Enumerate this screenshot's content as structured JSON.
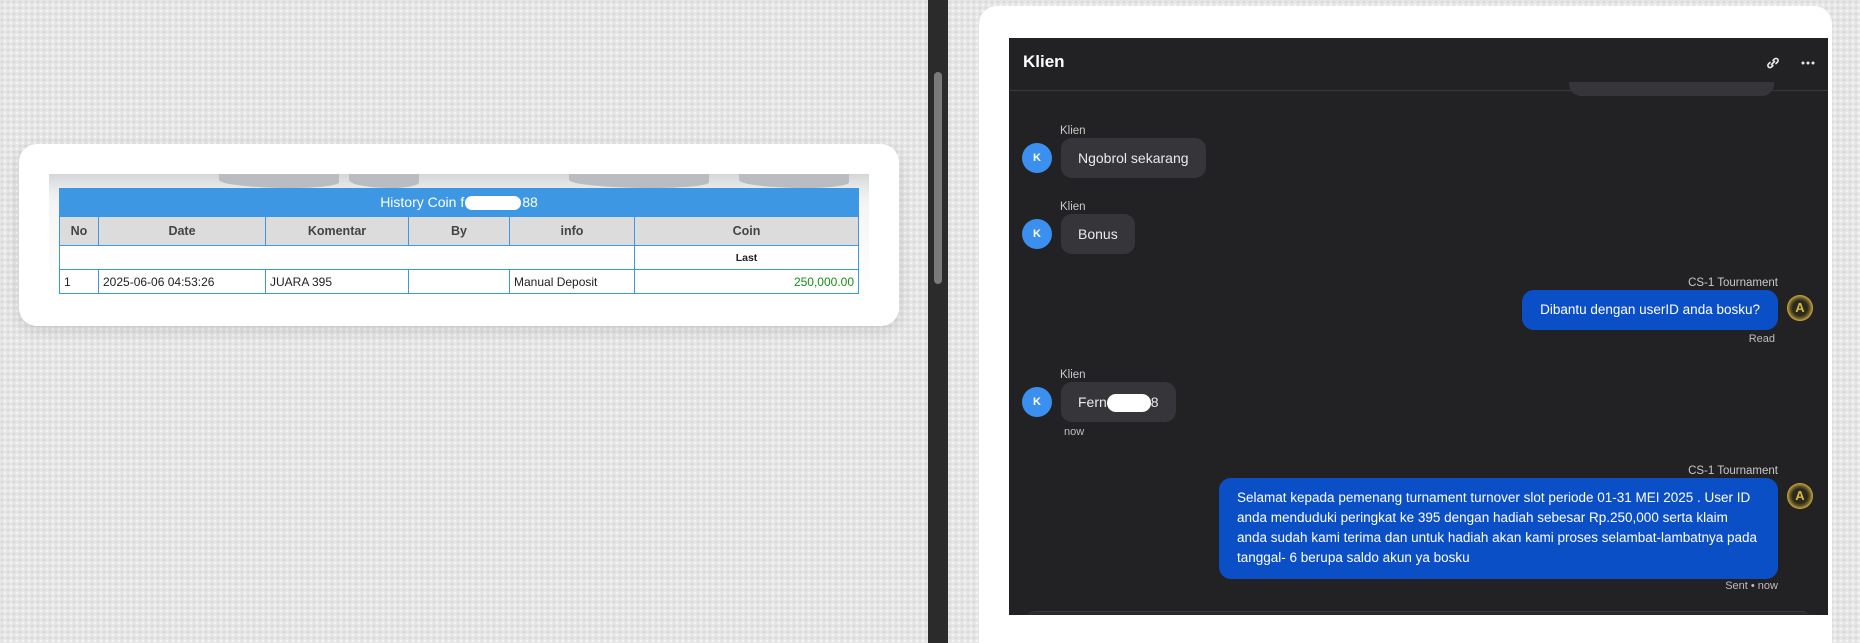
{
  "history": {
    "title_prefix": "History Coin f",
    "title_suffix": "88",
    "columns": [
      "No",
      "Date",
      "Komentar",
      "By",
      "info",
      "Coin"
    ],
    "last_label": "Last",
    "rows": [
      {
        "no": "1",
        "date": "2025-06-06 04:53:26",
        "komentar": "JUARA 395",
        "by": "",
        "info": "Manual Deposit",
        "coin": "250,000.00"
      }
    ]
  },
  "chat": {
    "title": "Klien",
    "header_icons": [
      "link-icon",
      "more-icon"
    ],
    "messages": [
      {
        "sender": "Klien",
        "avatar": "K",
        "text": "Ngobrol sekarang"
      },
      {
        "sender": "Klien",
        "avatar": "K",
        "text": "Bonus"
      },
      {
        "sender": "CS-1 Tournament",
        "text": "Dibantu dengan userID anda bosku?",
        "status": "Read"
      },
      {
        "sender": "Klien",
        "avatar": "K",
        "text_prefix": "Fern",
        "text_suffix": "8",
        "time": "now"
      },
      {
        "sender": "CS-1 Tournament",
        "text": "Selamat kepada pemenang turnament turnover slot periode 01-31 MEI 2025 . User ID anda menduduki peringkat ke 395 dengan hadiah sebesar Rp.250,000 serta klaim anda sudah kami terima dan untuk hadiah akan kami proses selambat-lambatnya pada tanggal- 6 berupa saldo akun ya bosku",
        "status": "Sent • now"
      }
    ]
  },
  "colors": {
    "table_header": "#3d97e3",
    "coin_amount": "#1a8a1a",
    "chat_bg": "#222225",
    "incoming_bubble": "#36363a",
    "outgoing_bubble": "#0b4fc6",
    "avatar_blue": "#3b8fef"
  }
}
